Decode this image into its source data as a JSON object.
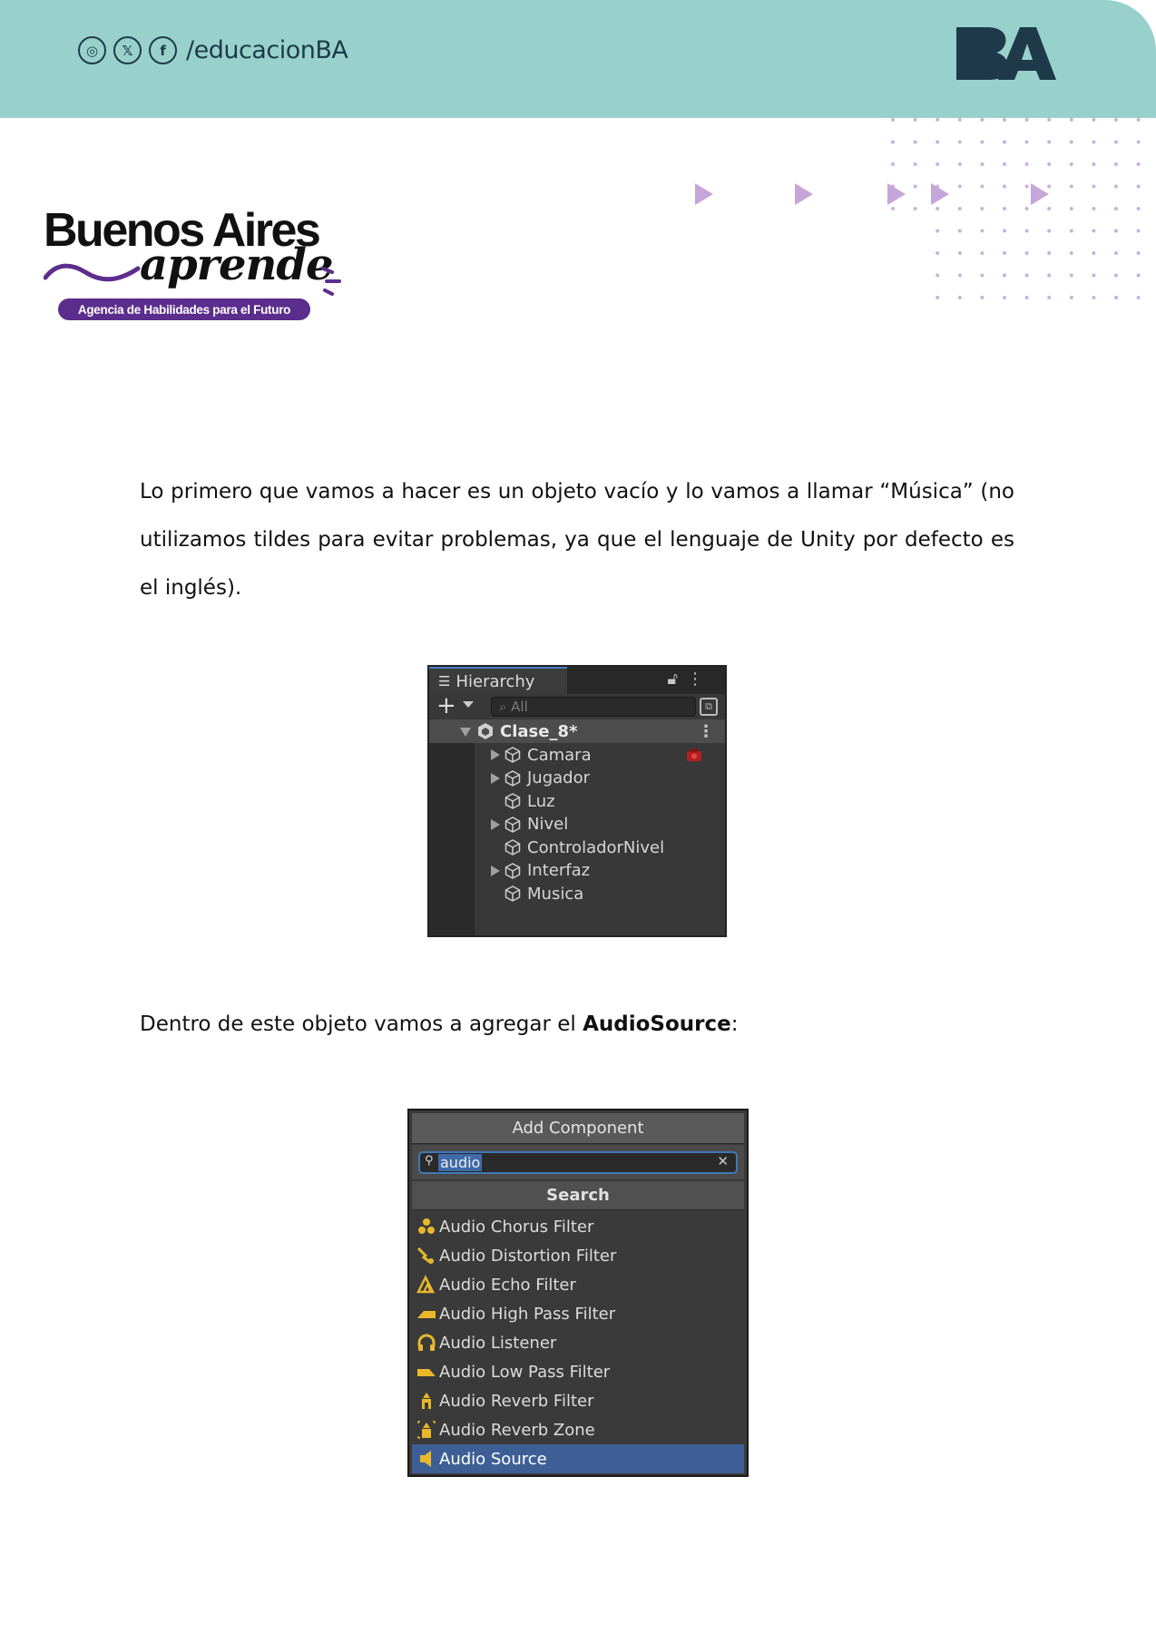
{
  "header": {
    "social_icons": [
      "instagram-icon",
      "x-twitter-icon",
      "facebook-icon"
    ],
    "social_glyphs": [
      "◎",
      "𝕏",
      "f"
    ],
    "handle": "/educacionBA",
    "brand_logo": "BA"
  },
  "logo": {
    "title": "Buenos Aires",
    "script": "aprende",
    "tagline": "Agencia de Habilidades para el Futuro"
  },
  "body": {
    "paragraph1": "Lo primero que vamos a hacer es un objeto vacío y lo vamos a llamar “Música” (no utilizamos tildes para evitar problemas, ya que el lenguaje de Unity por defecto es el inglés).",
    "paragraph2_before": "Dentro de este objeto vamos a agregar el ",
    "paragraph2_bold": "AudioSource",
    "paragraph2_after": ":"
  },
  "hierarchy": {
    "tab_label": "Hierarchy",
    "search_placeholder": "All",
    "scene": "Clase_8*",
    "items": [
      {
        "label": "Camara",
        "expandable": true
      },
      {
        "label": "Jugador",
        "expandable": true
      },
      {
        "label": "Luz",
        "expandable": false
      },
      {
        "label": "Nivel",
        "expandable": true
      },
      {
        "label": "ControladorNivel",
        "expandable": false
      },
      {
        "label": "Interfaz",
        "expandable": true
      },
      {
        "label": "Musica",
        "expandable": false
      }
    ]
  },
  "add_component": {
    "title": "Add Component",
    "search_value": "audio",
    "section": "Search",
    "items": [
      {
        "label": "Audio Chorus Filter",
        "icon": "audio-chorus-filter-icon"
      },
      {
        "label": "Audio Distortion Filter",
        "icon": "audio-distortion-filter-icon"
      },
      {
        "label": "Audio Echo Filter",
        "icon": "audio-echo-filter-icon"
      },
      {
        "label": "Audio High Pass Filter",
        "icon": "audio-high-pass-filter-icon"
      },
      {
        "label": "Audio Listener",
        "icon": "headphones-icon"
      },
      {
        "label": "Audio Low Pass Filter",
        "icon": "audio-low-pass-filter-icon"
      },
      {
        "label": "Audio Reverb Filter",
        "icon": "audio-reverb-filter-icon"
      },
      {
        "label": "Audio Reverb Zone",
        "icon": "audio-reverb-zone-icon"
      },
      {
        "label": "Audio Source",
        "icon": "speaker-icon",
        "selected": true
      }
    ]
  },
  "colors": {
    "header_teal": "#98d1cb",
    "dark_navy": "#1e3a4a",
    "brand_purple": "#5b2d8c",
    "decor_lilac": "#c6a6d9",
    "unity_selection": "#3e5f96"
  }
}
